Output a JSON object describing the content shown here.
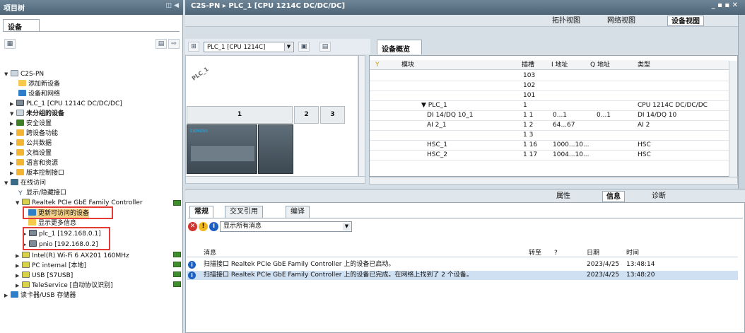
{
  "left": {
    "title": "项目树",
    "devices_tab": "设备",
    "tree": [
      {
        "label": "C2S-PN",
        "icon": "project-icon",
        "arrow": "▼"
      },
      {
        "label": "添加新设备",
        "icon": "add-device-icon",
        "arrow": ""
      },
      {
        "label": "设备和网络",
        "icon": "network-icon",
        "arrow": ""
      },
      {
        "label": "PLC_1 [CPU 1214C DC/DC/DC]",
        "icon": "plc-icon",
        "arrow": "▶"
      },
      {
        "label": "未分组的设备",
        "icon": "folder-icon",
        "arrow": "▼"
      },
      {
        "label": "安全设置",
        "icon": "security-icon",
        "arrow": "▶"
      },
      {
        "label": "跨设备功能",
        "icon": "cross-device-icon",
        "arrow": "▶"
      },
      {
        "label": "公共数据",
        "icon": "folder-icon",
        "arrow": "▶"
      },
      {
        "label": "文档设置",
        "icon": "folder-icon",
        "arrow": "▶"
      },
      {
        "label": "语言和资源",
        "icon": "folder-icon",
        "arrow": "▶"
      },
      {
        "label": "版本控制接口",
        "icon": "folder-icon",
        "arrow": "▶"
      },
      {
        "label": "在线访问",
        "icon": "online-icon",
        "arrow": "▼"
      },
      {
        "label": "显示/隐藏接口",
        "icon": "filter-icon",
        "arrow": ""
      },
      {
        "label": "Realtek PCIe GbE Family Controller",
        "icon": "nic-icon",
        "arrow": "▼"
      },
      {
        "label": "更新可访问的设备",
        "icon": "update-icon",
        "arrow": ""
      },
      {
        "label": "显示更多信息",
        "icon": "info-icon",
        "arrow": ""
      },
      {
        "label": "plc_1 [192.168.0.1]",
        "icon": "plc-icon",
        "arrow": "▶"
      },
      {
        "label": "pnio [192.168.0.2]",
        "icon": "plc-icon",
        "arrow": "▶"
      },
      {
        "label": "Intel(R) Wi-Fi 6 AX201 160MHz",
        "icon": "nic-icon",
        "arrow": "▶"
      },
      {
        "label": "PC internal [本地]",
        "icon": "nic-icon",
        "arrow": "▶"
      },
      {
        "label": "USB [S7USB]",
        "icon": "nic-icon",
        "arrow": "▶"
      },
      {
        "label": "TeleService [自动协议识别]",
        "icon": "nic-icon",
        "arrow": "▶"
      },
      {
        "label": "读卡器/USB 存储器",
        "icon": "card-reader-icon",
        "arrow": "▶"
      }
    ]
  },
  "editor": {
    "breadcrumb": "C2S-PN ▸ PLC_1 [CPU 1214C DC/DC/DC]",
    "window_controls": "_ ▪ ▪ ✕",
    "views": [
      "拓扑视图",
      "网络视图",
      "设备视图"
    ],
    "plc_select": "PLC_1 [CPU 1214C]",
    "rack_label": "PLC_1",
    "slots": [
      "1",
      "2",
      "3"
    ],
    "cpu_brand": "SIEMENS"
  },
  "overview": {
    "tab": "设备概览",
    "headers": [
      "模块",
      "插槽",
      "I 地址",
      "Q 地址",
      "类型"
    ],
    "rows": [
      {
        "module": "",
        "slot": "103",
        "i": "",
        "q": "",
        "type": ""
      },
      {
        "module": "",
        "slot": "102",
        "i": "",
        "q": "",
        "type": ""
      },
      {
        "module": "",
        "slot": "101",
        "i": "",
        "q": "",
        "type": ""
      },
      {
        "module": "▼ PLC_1",
        "slot": "1",
        "i": "",
        "q": "",
        "type": "CPU 1214C DC/DC/DC"
      },
      {
        "module": "DI 14/DQ 10_1",
        "slot": "1 1",
        "i": "0...1",
        "q": "0...1",
        "type": "DI 14/DQ 10"
      },
      {
        "module": "AI 2_1",
        "slot": "1 2",
        "i": "64...67",
        "q": "",
        "type": "AI 2"
      },
      {
        "module": "",
        "slot": "1 3",
        "i": "",
        "q": "",
        "type": ""
      },
      {
        "module": "HSC_1",
        "slot": "1 16",
        "i": "1000...10...",
        "q": "",
        "type": "HSC"
      },
      {
        "module": "HSC_2",
        "slot": "1 17",
        "i": "1004...10...",
        "q": "",
        "type": "HSC"
      }
    ]
  },
  "inspector": {
    "tabs_right": [
      "属性",
      "信息",
      "诊断"
    ],
    "tabs": [
      "常规",
      "交叉引用",
      "编译"
    ],
    "filter": "显示所有消息",
    "headers": [
      "消息",
      "转至",
      "?",
      "日期",
      "时间"
    ],
    "messages": [
      {
        "text": "扫描接口 Realtek PCIe GbE Family Controller 上的设备已启动。",
        "date": "2023/4/25",
        "time": "13:48:14"
      },
      {
        "text": "扫描接口 Realtek PCIe GbE Family Controller 上的设备已完成。在网络上找到了 2 个设备。",
        "date": "2023/4/25",
        "time": "13:48:20"
      }
    ]
  }
}
